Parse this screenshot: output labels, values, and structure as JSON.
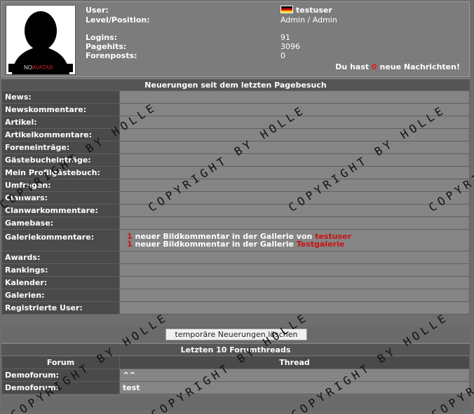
{
  "profile": {
    "avatar_caption_no": "NO",
    "avatar_caption_avatar": "AVATAR",
    "labels": {
      "user": "User:",
      "level": "Level/Position:",
      "logins": "Logins:",
      "pagehits": "Pagehits:",
      "forenposts": "Forenposts:"
    },
    "values": {
      "user": "testuser",
      "level": "Admin / Admin",
      "logins": "91",
      "pagehits": "3096",
      "forenposts": "0"
    },
    "flag": "german-flag-icon",
    "messages": {
      "prefix": "Du hast",
      "count": "0",
      "suffix": "neue Nachrichten!"
    }
  },
  "news_section": {
    "title": "Neuerungen seit dem letzten Pagebesuch",
    "rows": [
      {
        "label": "News:"
      },
      {
        "label": "Newskommentare:"
      },
      {
        "label": "Artikel:"
      },
      {
        "label": "Artikelkommentare:"
      },
      {
        "label": "Foreneinträge:"
      },
      {
        "label": "Gästebucheinträge:"
      },
      {
        "label": "Mein Profilgästebuch:"
      },
      {
        "label": "Umfragen:"
      },
      {
        "label": "Clanwars:"
      },
      {
        "label": "Clanwarkommentare:"
      },
      {
        "label": "Gamebase:"
      }
    ],
    "gallery": {
      "label": "Galeriekommentare:",
      "lines": [
        {
          "count": "1",
          "text": " neuer Bildkommentar in der Gallerie von ",
          "link": "testuser"
        },
        {
          "count": "1",
          "text": " neuer Bildkommentar in der Gallerie ",
          "link": "Testgalerie"
        }
      ]
    },
    "rows2": [
      {
        "label": "Awards:"
      },
      {
        "label": "Rankings:"
      },
      {
        "label": "Kalender:"
      },
      {
        "label": "Galerien:"
      },
      {
        "label": "Registrierte User:"
      }
    ],
    "clear_button": "temporäre Neuerungen löschen"
  },
  "forum_section": {
    "title": "Letzten 10 Forumthreads",
    "col_forum": "Forum",
    "col_thread": "Thread",
    "rows": [
      {
        "forum": "Demoforum:",
        "thread": "^^"
      },
      {
        "forum": "Demoforum:",
        "thread": "test"
      }
    ]
  },
  "watermark": "COPYRIGHT BY HOLLE"
}
